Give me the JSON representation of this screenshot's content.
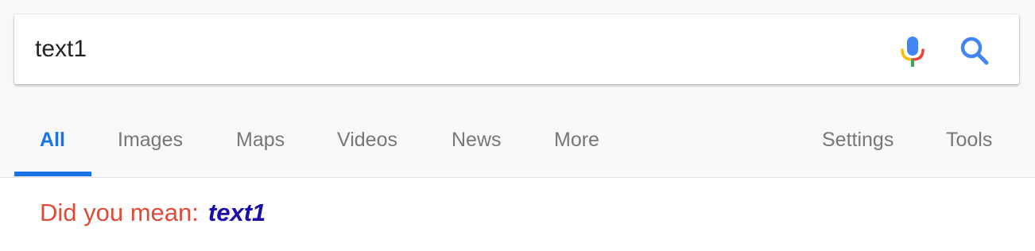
{
  "search": {
    "query": "text1",
    "mic_icon": "microphone-icon",
    "search_icon": "magnifier-icon"
  },
  "tabs": [
    {
      "label": "All",
      "active": true
    },
    {
      "label": "Images"
    },
    {
      "label": "Maps"
    },
    {
      "label": "Videos"
    },
    {
      "label": "News"
    },
    {
      "label": "More"
    },
    {
      "label": "Settings"
    },
    {
      "label": "Tools"
    }
  ],
  "suggestion": {
    "label": "Did you mean:",
    "query": "text1"
  },
  "colors": {
    "accent_blue": "#1a73e8",
    "tab_gray": "#777777",
    "suggestion_red": "#dd4b39",
    "link_navy": "#1a0dab",
    "mic_blue": "#4285f4",
    "mic_green": "#34a853",
    "mic_yellow": "#fbbc05",
    "mic_red": "#ea4335"
  }
}
